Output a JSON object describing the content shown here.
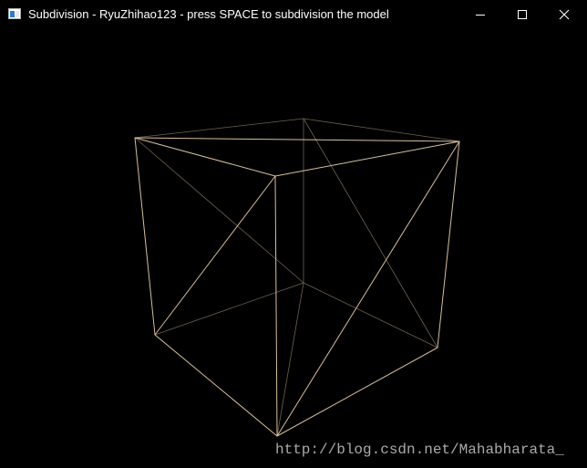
{
  "window": {
    "title": "Subdivision - RyuZhihao123 - press SPACE to subdivision the model",
    "icon": "opengl-window-icon",
    "controls": {
      "minimize": "minimize-icon",
      "maximize": "maximize-icon",
      "close": "close-icon"
    }
  },
  "scene": {
    "background": "#000000",
    "wire_color": "#d9c09a",
    "model": "octahedron-in-cube wireframe"
  },
  "watermark": {
    "text": "http://blog.csdn.net/Mahabharata_"
  }
}
